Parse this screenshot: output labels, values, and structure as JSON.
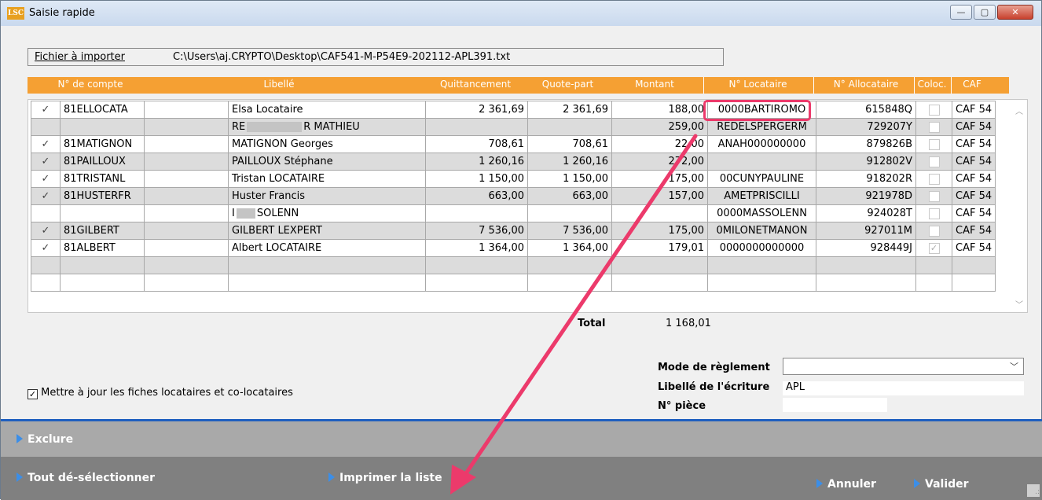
{
  "window": {
    "icon_text": "LSC",
    "title": "Saisie rapide",
    "minimize_glyph": "—",
    "maximize_glyph": "▢",
    "close_glyph": "✕"
  },
  "fichier": {
    "label": "Fichier à importer",
    "path": "C:\\Users\\aj.CRYPTO\\Desktop\\CAF541-M-P54E9-202112-APL391.txt"
  },
  "columns": [
    "N° de compte",
    "Libellé",
    "Quittancement",
    "Quote-part",
    "Montant",
    "N° Locataire",
    "N° Allocataire",
    "Coloc.",
    "CAF"
  ],
  "rows": [
    {
      "check": "✓",
      "compte": "81ELLOCATA",
      "extra": "",
      "libelle": "Elsa Locataire",
      "quitt": "2 361,69",
      "quote": "2 361,69",
      "montant": "188,00",
      "locataire": "0000BARTIROMO",
      "allocataire": "615848Q",
      "coloc": "",
      "caf": "CAF 54"
    },
    {
      "check": "",
      "compte": "",
      "extra": "",
      "libelle": "RE",
      "libelle_tail": "R MATHIEU",
      "quitt": "",
      "quote": "",
      "montant": "259,00",
      "locataire": "REDELSPERGERM",
      "allocataire": "729207Y",
      "coloc": "",
      "caf": "CAF 54"
    },
    {
      "check": "✓",
      "compte": "81MATIGNON",
      "extra": "",
      "libelle": "MATIGNON Georges",
      "quitt": "708,61",
      "quote": "708,61",
      "montant": "22,00",
      "locataire": "ANAH000000000",
      "allocataire": "879826B",
      "coloc": "",
      "caf": "CAF 54"
    },
    {
      "check": "✓",
      "compte": "81PAILLOUX",
      "extra": "",
      "libelle": "PAILLOUX Stéphane",
      "quitt": "1 260,16",
      "quote": "1 260,16",
      "montant": "272,00",
      "locataire": "",
      "allocataire": "912802V",
      "coloc": "",
      "caf": "CAF 54"
    },
    {
      "check": "✓",
      "compte": "81TRISTANL",
      "extra": "",
      "libelle": "Tristan LOCATAIRE",
      "quitt": "1 150,00",
      "quote": "1 150,00",
      "montant": "175,00",
      "locataire": "00CUNYPAULINE",
      "allocataire": "918202R",
      "coloc": "",
      "caf": "CAF 54"
    },
    {
      "check": "✓",
      "compte": "81HUSTERFR",
      "extra": "",
      "libelle": "Huster Francis",
      "quitt": "663,00",
      "quote": "663,00",
      "montant": "157,00",
      "locataire": "AMETPRISCILLI",
      "allocataire": "921978D",
      "coloc": "",
      "caf": "CAF 54"
    },
    {
      "check": "",
      "compte": "",
      "extra": "",
      "libelle": "I",
      "libelle_tail": "SOLENN",
      "quitt": "",
      "quote": "",
      "montant": "",
      "locataire": "0000MASSOLENN",
      "allocataire": "924028T",
      "coloc": "",
      "caf": "CAF 54"
    },
    {
      "check": "✓",
      "compte": "81GILBERT",
      "extra": "",
      "libelle": "GILBERT LEXPERT",
      "quitt": "7 536,00",
      "quote": "7 536,00",
      "montant": "175,00",
      "locataire": "0MILONETMANON",
      "allocataire": "927011M",
      "coloc": "",
      "caf": "CAF 54"
    },
    {
      "check": "✓",
      "compte": "81ALBERT",
      "extra": "",
      "libelle": "Albert LOCATAIRE",
      "quitt": "1 364,00",
      "quote": "1 364,00",
      "montant": "179,01",
      "locataire": "0000000000000",
      "allocataire": "928449J",
      "coloc": "✓",
      "caf": "CAF 54"
    }
  ],
  "total": {
    "label": "Total",
    "value": "1 168,01"
  },
  "form": {
    "mode_label": "Mode de règlement",
    "mode_value": "",
    "libelle_label": "Libellé de l'écriture",
    "libelle_value": "APL",
    "piece_label": "N° pièce",
    "piece_value": ""
  },
  "maj_checkbox": {
    "checked": true,
    "label": "Mettre à jour les fiches locataires et co-locataires"
  },
  "actions": {
    "exclure": "Exclure",
    "deselect": "Tout dé-sélectionner",
    "imprimer": "Imprimer la liste",
    "annuler": "Annuler",
    "valider": "Valider"
  },
  "colors": {
    "header_orange": "#f5a033",
    "highlight_pink": "#ec3a6b",
    "action_blue": "#3b8ee8",
    "divider_blue": "#1f5fbf"
  }
}
